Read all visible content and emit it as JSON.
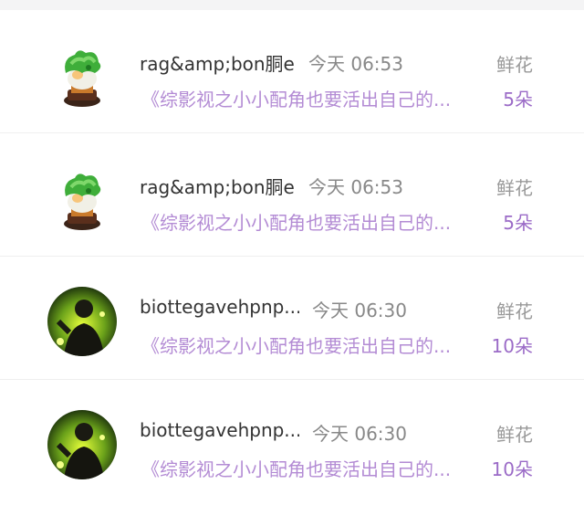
{
  "colors": {
    "name_text": "#333333",
    "time_text": "#888888",
    "title_text": "#b38bd4",
    "gift_label_text": "#999999",
    "gift_count_text": "#9b6bc7"
  },
  "records": [
    {
      "avatar_icon": "jade-cabbage-avatar-icon",
      "user_name": "rag&amp;bon胴e",
      "time": "今天 06:53",
      "novel_title": "《综影视之小小配角也要活出自己的...",
      "gift_label": "鲜花",
      "gift_count": "5朵"
    },
    {
      "avatar_icon": "jade-cabbage-avatar-icon",
      "user_name": "rag&amp;bon胴e",
      "time": "今天 06:53",
      "novel_title": "《综影视之小小配角也要活出自己的...",
      "gift_label": "鲜花",
      "gift_count": "5朵"
    },
    {
      "avatar_icon": "person-green-glow-avatar-icon",
      "user_name": "biottegavehpnp...",
      "time": "今天 06:30",
      "novel_title": "《综影视之小小配角也要活出自己的...",
      "gift_label": "鲜花",
      "gift_count": "10朵"
    },
    {
      "avatar_icon": "person-green-glow-avatar-icon",
      "user_name": "biottegavehpnp...",
      "time": "今天 06:30",
      "novel_title": "《综影视之小小配角也要活出自己的...",
      "gift_label": "鲜花",
      "gift_count": "10朵"
    }
  ]
}
